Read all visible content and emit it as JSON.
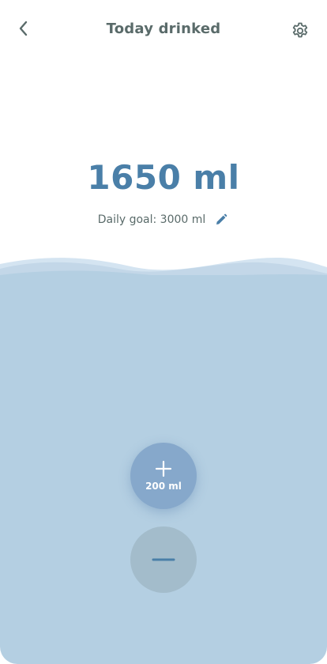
{
  "header": {
    "title": "Today drinked",
    "back_icon": "chevron-left-icon",
    "settings_icon": "gear-icon"
  },
  "intake": {
    "amount": "1650 ml",
    "goal": "Daily goal: 3000 ml",
    "edit_icon": "pencil-icon"
  },
  "actions": {
    "add_label": "200 ml",
    "add_icon": "plus-icon",
    "remove_icon": "minus-icon"
  },
  "colors": {
    "accent": "#4a7fa8",
    "water": "#b4cfe2",
    "add_button": "#86a8cb",
    "remove_button": "#a3bccb",
    "text": "#5a6b6a"
  }
}
